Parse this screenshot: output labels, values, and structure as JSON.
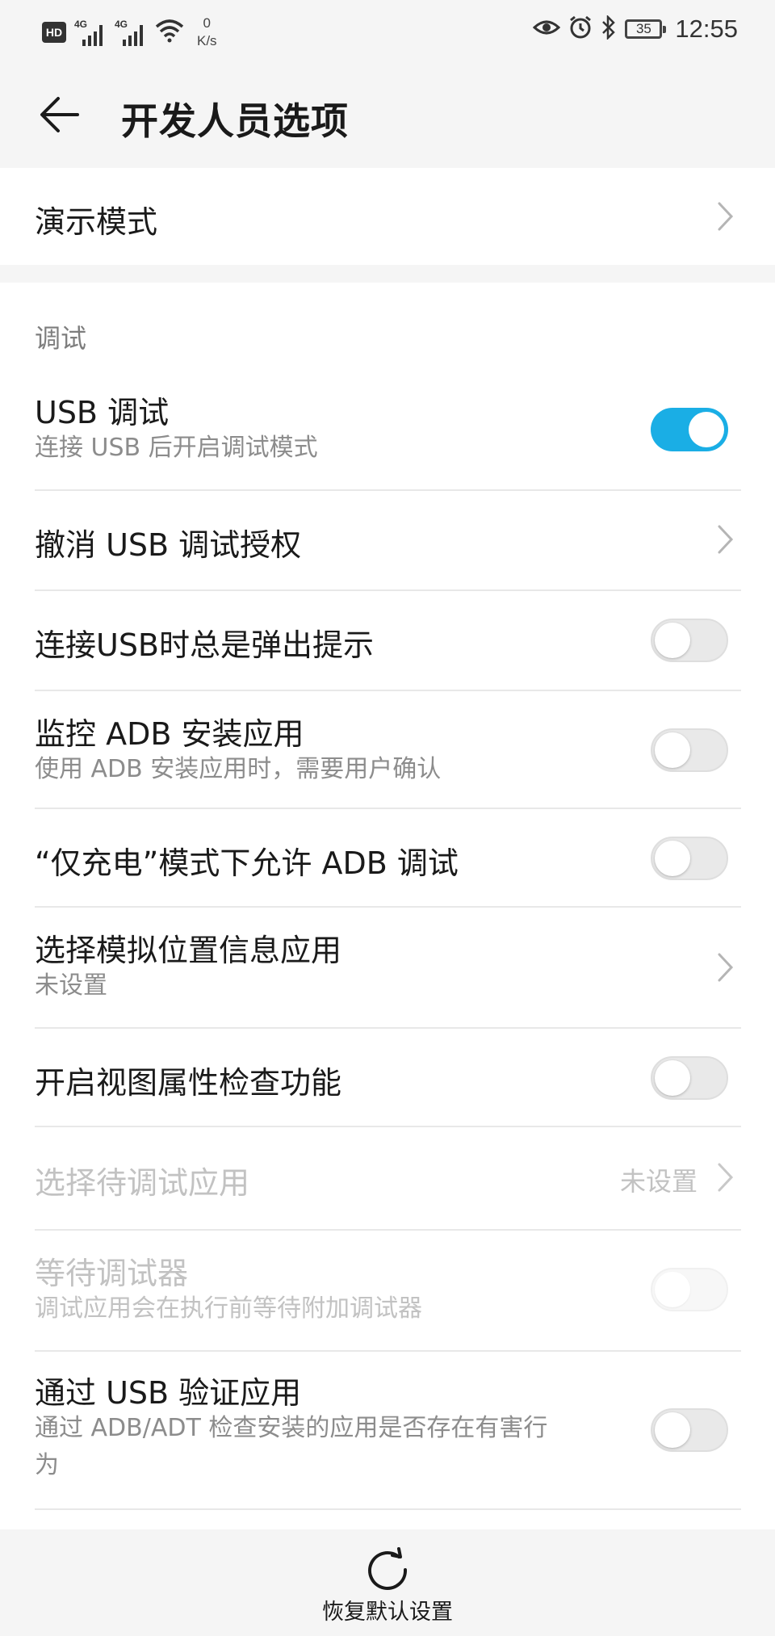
{
  "status_bar": {
    "hd": "HD",
    "sim1": "4G",
    "sim2": "4G",
    "net_speed_value": "0",
    "net_speed_unit": "K/s",
    "battery": "35",
    "time": "12:55"
  },
  "header": {
    "title": "开发人员选项"
  },
  "demo_mode": {
    "title": "演示模式"
  },
  "debug_section": {
    "header": "调试",
    "items": [
      {
        "title": "USB 调试",
        "subtitle": "连接 USB 后开启调试模式",
        "control": "toggle",
        "state": "on"
      },
      {
        "title": "撤消 USB 调试授权",
        "control": "chevron"
      },
      {
        "title": "连接USB时总是弹出提示",
        "control": "toggle",
        "state": "off"
      },
      {
        "title": "监控 ADB 安装应用",
        "subtitle": "使用 ADB 安装应用时，需要用户确认",
        "control": "toggle",
        "state": "off"
      },
      {
        "title": "“仅充电”模式下允许 ADB 调试",
        "control": "toggle",
        "state": "off"
      },
      {
        "title": "选择模拟位置信息应用",
        "subtitle": "未设置",
        "control": "chevron"
      },
      {
        "title": "开启视图属性检查功能",
        "control": "toggle",
        "state": "off"
      },
      {
        "title": "选择待调试应用",
        "value": "未设置",
        "control": "chevron",
        "disabled": true
      },
      {
        "title": "等待调试器",
        "subtitle": "调试应用会在执行前等待附加调试器",
        "control": "toggle",
        "state": "off",
        "disabled": true
      },
      {
        "title": "通过 USB 验证应用",
        "subtitle_line1": "通过 ADB/ADT 检查安装的应用是否存在有害行",
        "subtitle_line2": "为",
        "control": "toggle",
        "state": "off"
      }
    ]
  },
  "bottom": {
    "reset_label": "恢复默认设置"
  },
  "colors": {
    "accent": "#1aaee5",
    "background": "#f5f5f5",
    "card": "#ffffff"
  },
  "icons": [
    "back-arrow-icon",
    "chevron-right-icon",
    "refresh-icon",
    "eye-icon",
    "alarm-icon",
    "bluetooth-icon",
    "wifi-icon",
    "signal-icon",
    "battery-icon"
  ]
}
